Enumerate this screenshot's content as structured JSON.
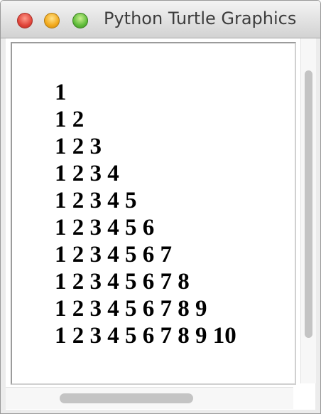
{
  "window": {
    "title": "Python Turtle Graphics"
  },
  "canvas": {
    "lines": [
      "1",
      "1 2",
      "1 2 3",
      "1 2 3 4",
      "1 2 3 4 5",
      "1 2 3 4 5 6",
      "1 2 3 4 5 6 7",
      "1 2 3 4 5 6 7 8",
      "1 2 3 4 5 6 7 8 9",
      "1 2 3 4 5 6 7 8 9 10"
    ]
  },
  "colors": {
    "text": "#000000",
    "canvas_background": "#ffffff",
    "scrollbar_thumb": "#c4c4c4"
  },
  "icons": [
    "close-button",
    "minimize-button",
    "zoom-button"
  ]
}
